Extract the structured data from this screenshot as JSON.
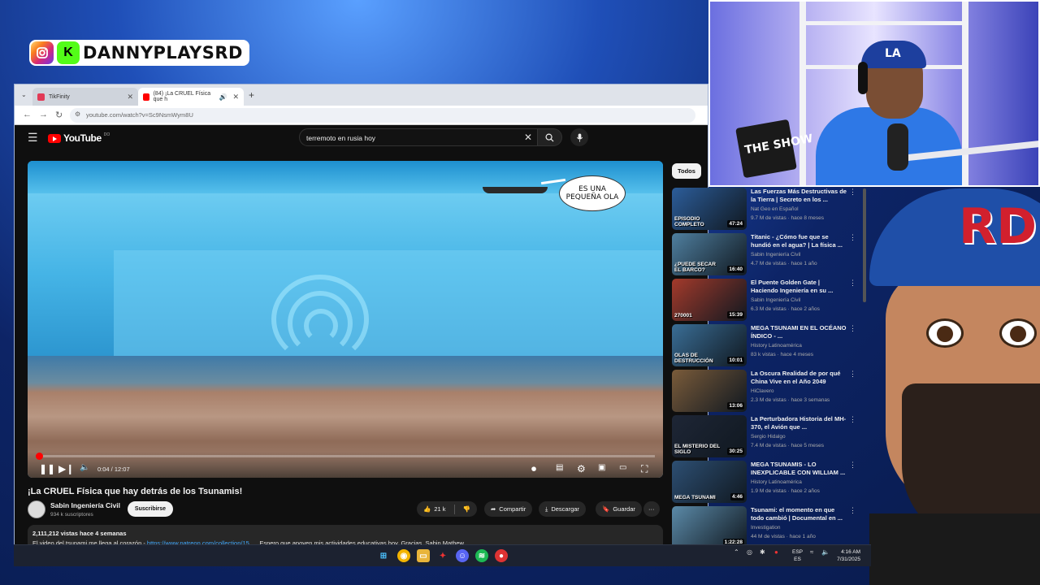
{
  "overlay": {
    "brand_name": "DANNYPLAYSRD",
    "webcam_box_text": "THE SHOW"
  },
  "browser": {
    "tabs": [
      {
        "label": "TikFinity"
      },
      {
        "label": "(84) ¡La CRUEL Física que h"
      }
    ],
    "url": "youtube.com/watch?v=Sc9NsmWym8U"
  },
  "youtube": {
    "logo_text": "YouTube",
    "logo_region": "DO",
    "search_value": "terremoto en rusia hoy",
    "video": {
      "bubble_line1": "ES UNA",
      "bubble_line2": "PEQUEÑA OLA",
      "time": "0:04 / 12:07",
      "progress": 0.0055,
      "title": "¡La CRUEL Física que hay detrás de los Tsunamis!",
      "channel": "Sabin Ingeniería Civil",
      "subscribers": "934 k suscriptores",
      "subscribe_label": "Suscribirse",
      "likes": "21 k",
      "share_label": "Compartir",
      "download_label": "Descargar",
      "save_label": "Guardar",
      "stats": "2,111,212 vistas  hace 4 semanas",
      "desc_prefix": "El video del tsunami me llega al corazón - ",
      "desc_link": "https://www.patreon.com/collection/15...",
      "desc_suffix": " . Espero que apoyen mis actividades educativas hoy. Gracias. Sabin Mathew."
    },
    "filter_chip": "Todos",
    "recommended": [
      {
        "title": "Las Fuerzas Más Destructivas de la Tierra | Secreto en los ...",
        "channel": "Nat Geo en Español",
        "meta": "9.7 M de vistas · hace 8 meses",
        "duration": "47:24",
        "thumb_caption": "EPISODIO COMPLETO",
        "thumb_color": "#2c5d9a"
      },
      {
        "title": "Titanic - ¿Cómo fue que se hundió en el agua? | La física ...",
        "channel": "Sabin Ingeniería Civil",
        "meta": "4.7 M de vistas · hace 1 año",
        "duration": "16:40",
        "thumb_caption": "¿PUEDE SECAR EL BARCO?",
        "thumb_color": "#4f7f9f"
      },
      {
        "title": "El Puente Golden Gate | Haciendo Ingeniería en su ...",
        "channel": "Sabin Ingeniería Civil",
        "meta": "6.3 M de vistas · hace 2 años",
        "duration": "15:39",
        "thumb_caption": "270001",
        "thumb_color": "#a33a2b"
      },
      {
        "title": "MEGA TSUNAMI EN EL OCÉANO ÍNDICO - ...",
        "channel": "History Latinoamérica",
        "meta": "83 k vistas · hace 4 meses",
        "duration": "10:01",
        "thumb_caption": "OLAS DE DESTRUCCIÓN",
        "thumb_color": "#3a6e96"
      },
      {
        "title": "La Oscura Realidad de por qué China Vive en el Año 2049",
        "channel": "HiClavero",
        "meta": "2.3 M de vistas · hace 3 semanas",
        "duration": "13:06",
        "thumb_caption": "",
        "thumb_color": "#7a5b3a"
      },
      {
        "title": "La Perturbadora Historia del MH-370, el Avión que ...",
        "channel": "Sergio Hidalgo",
        "meta": "7.4 M de vistas · hace 5 meses",
        "duration": "30:25",
        "thumb_caption": "EL MISTERIO DEL SIGLO",
        "thumb_color": "#1e2636"
      },
      {
        "title": "MEGA TSUNAMIS - LO INEXPLICABLE CON WILLIAM ...",
        "channel": "History Latinoamérica",
        "meta": "1.9 M de vistas · hace 2 años",
        "duration": "4:46",
        "thumb_caption": "MEGA TSUNAMI",
        "thumb_color": "#2d4f73"
      },
      {
        "title": "Tsunami: el momento en que todo cambió | Documental en ...",
        "channel": "Investigation",
        "meta": "44 M de vistas · hace 1 año",
        "duration": "1:22:28",
        "thumb_caption": "",
        "thumb_color": "#5b8aa8"
      }
    ]
  },
  "taskbar": {
    "lang_top": "ESP",
    "lang_bottom": "ES",
    "time": "4:16 AM",
    "date": "7/31/2025"
  }
}
